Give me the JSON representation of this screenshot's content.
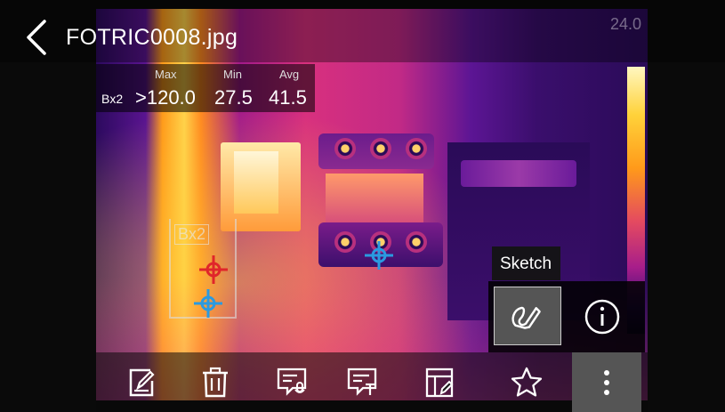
{
  "header": {
    "file_name": "FOTRIC0008.jpg",
    "scale_max": "24.0"
  },
  "stats": {
    "region_label": "Bx2",
    "columns": [
      {
        "header": "Max",
        "value": ">120.0"
      },
      {
        "header": "Min",
        "value": "27.5"
      },
      {
        "header": "Avg",
        "value": "41.5"
      }
    ]
  },
  "measurement_box": {
    "label": "Bx2"
  },
  "popup": {
    "tooltip": "Sketch",
    "buttons": [
      {
        "name": "sketch",
        "icon": "sketch-icon"
      },
      {
        "name": "info",
        "icon": "info-icon"
      }
    ]
  },
  "toolbar": {
    "buttons": [
      {
        "name": "edit",
        "icon": "edit-icon"
      },
      {
        "name": "delete",
        "icon": "trash-icon"
      },
      {
        "name": "voice-note",
        "icon": "voice-note-icon"
      },
      {
        "name": "text-note",
        "icon": "text-note-icon"
      },
      {
        "name": "report",
        "icon": "report-edit-icon"
      },
      {
        "name": "favorite",
        "icon": "star-icon"
      },
      {
        "name": "more",
        "icon": "more-vertical-icon"
      }
    ]
  },
  "colors": {
    "accent_hot": "#ffd24a",
    "accent_cold": "#2a0b58",
    "marker_hot": "#e0262a",
    "marker_cold": "#2a9ae0",
    "toolbar_selected": "#555555"
  }
}
